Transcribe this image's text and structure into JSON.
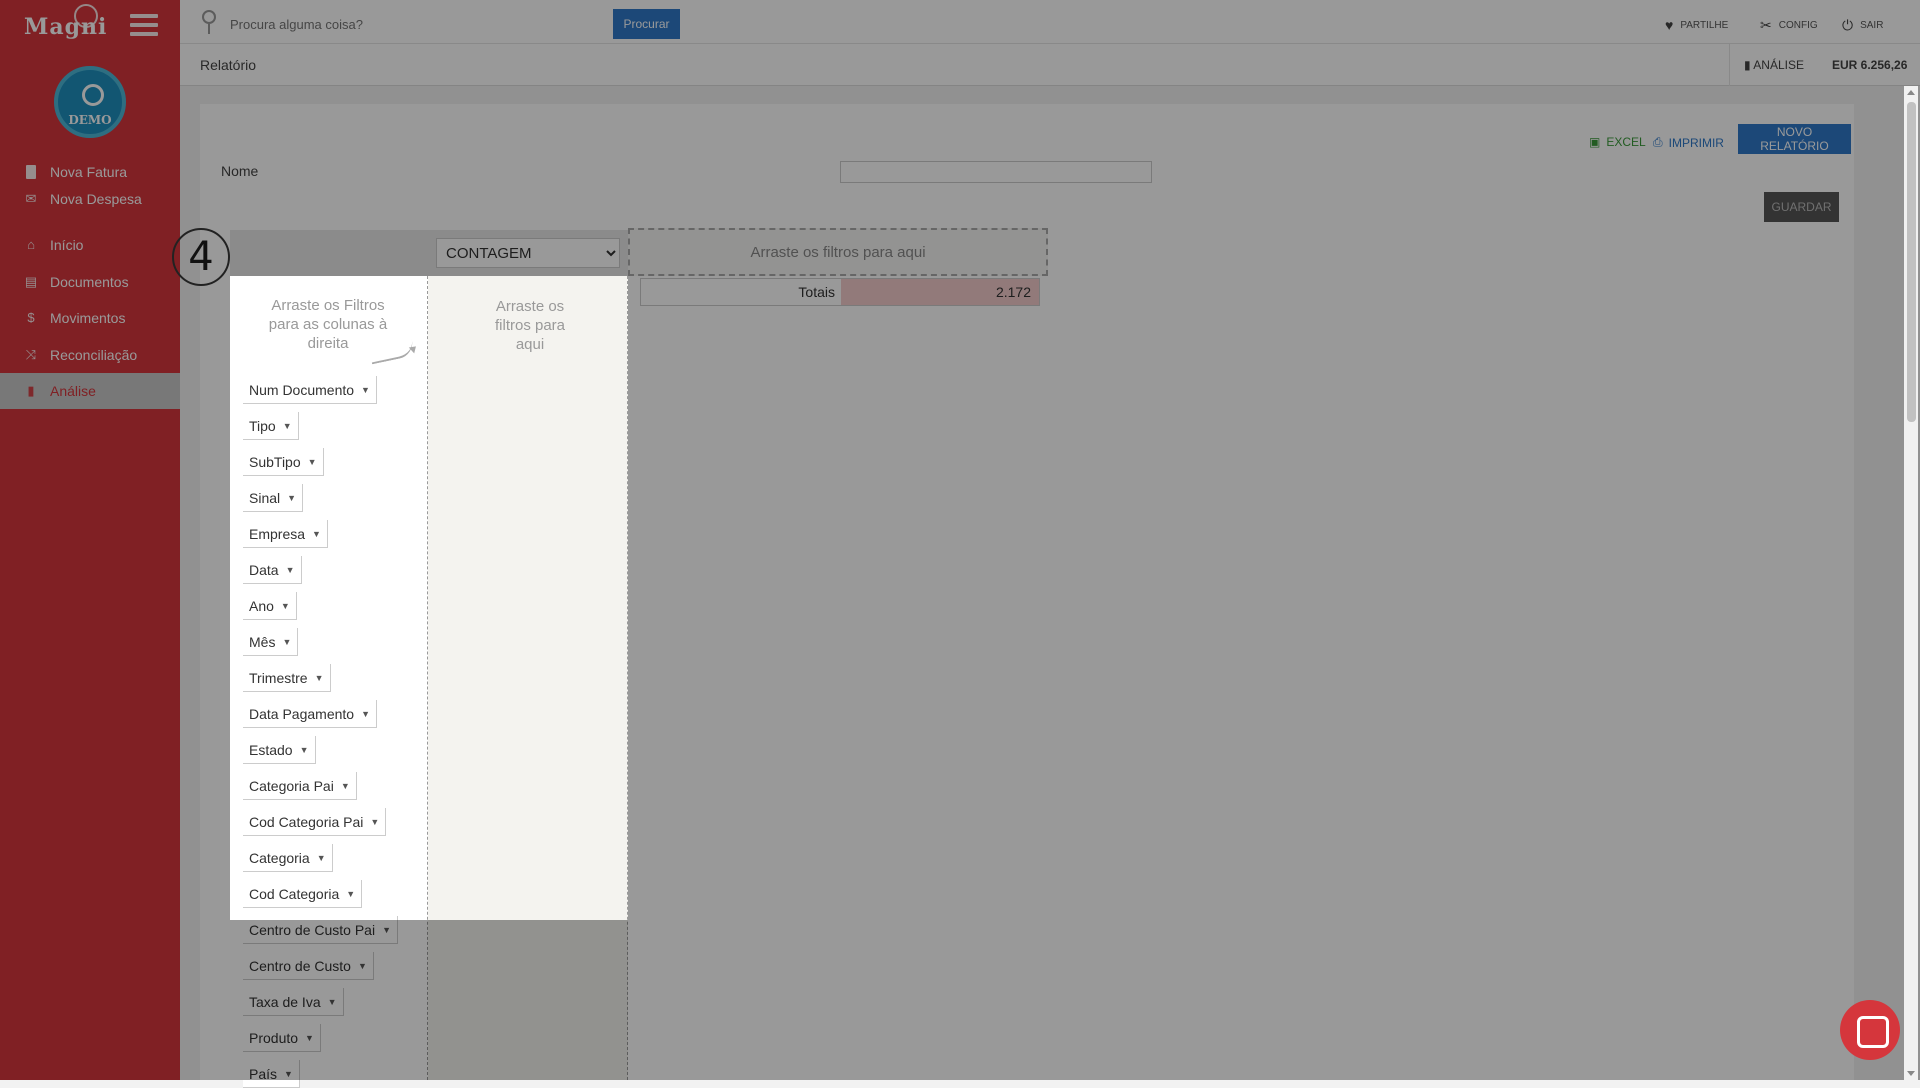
{
  "sidebar": {
    "logo": "Magni",
    "avatar_label": "DEMO",
    "quick_actions": [
      {
        "label": "Nova Fatura",
        "icon": "file-icon"
      },
      {
        "label": "Nova Despesa",
        "icon": "envelope-icon"
      }
    ],
    "items": [
      {
        "label": "Início",
        "icon": "home-icon"
      },
      {
        "label": "Documentos",
        "icon": "documents-icon"
      },
      {
        "label": "Movimentos",
        "icon": "dollar-icon"
      },
      {
        "label": "Reconciliação",
        "icon": "shuffle-icon"
      },
      {
        "label": "Análise",
        "icon": "bar-chart-icon",
        "active": true
      }
    ]
  },
  "topbar": {
    "search_placeholder": "Procura alguma coisa?",
    "search_button": "Procurar",
    "links": [
      {
        "label": "PARTILHE",
        "icon": "heart-icon"
      },
      {
        "label": "CONFIG",
        "icon": "tools-icon"
      },
      {
        "label": "SAIR",
        "icon": "power-icon"
      }
    ]
  },
  "subbar": {
    "title": "Relatório",
    "analysis_link": "ANÁLISE",
    "balance": "EUR 6.256,26"
  },
  "toolbar": {
    "excel": "EXCEL",
    "print": "IMPRIMIR",
    "new_report": "NOVO RELATÓRIO",
    "save": "GUARDAR"
  },
  "form": {
    "name_label": "Nome",
    "name_value": ""
  },
  "pivot": {
    "aggregator": "CONTAGEM",
    "aggregator_options": [
      "CONTAGEM"
    ],
    "col_drop_hint": "Arraste os filtros para aqui",
    "left_hint": "Arraste os Filtros para as colunas à direita",
    "row_drop_hint": "Arraste os filtros para aqui",
    "filters": [
      "Num Documento",
      "Tipo",
      "SubTipo",
      "Sinal",
      "Empresa",
      "Data",
      "Ano",
      "Mês",
      "Trimestre",
      "Data Pagamento",
      "Estado",
      "Categoria Pai",
      "Cod Categoria Pai",
      "Categoria",
      "Cod Categoria",
      "Centro de Custo Pai",
      "Centro de Custo",
      "Taxa de Iva",
      "Produto",
      "País"
    ],
    "totals_label": "Totais",
    "totals_value": "2.172"
  },
  "tutorial": {
    "step": "4"
  },
  "colors": {
    "brand": "#d5363c",
    "primary": "#2f79c9",
    "totals_cell": "#f4cccc"
  }
}
